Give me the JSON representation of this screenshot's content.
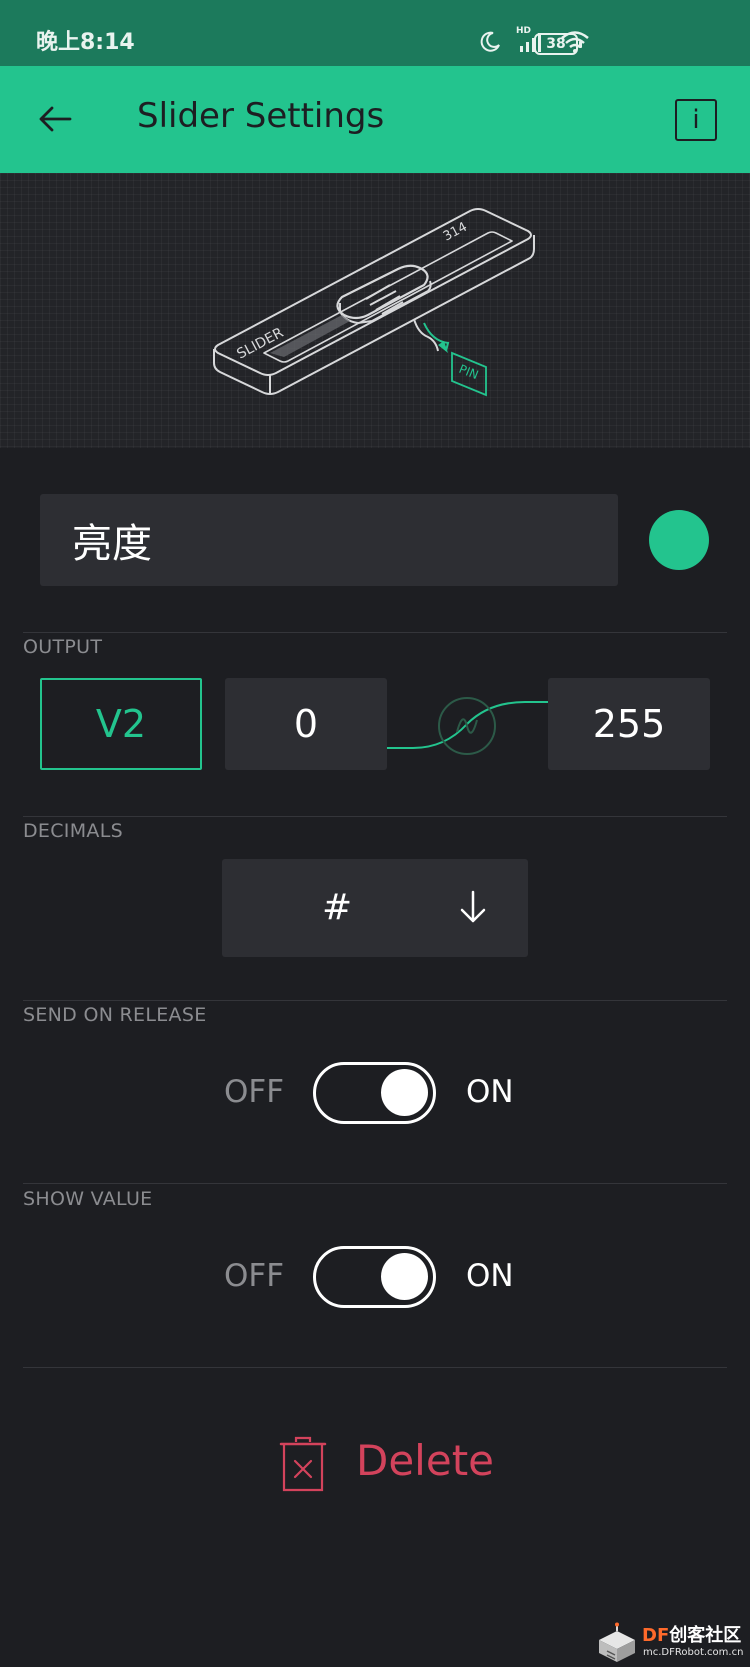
{
  "status_bar": {
    "time": "晚上8:14",
    "network_label": "HD",
    "battery": "38",
    "icons": [
      "moon-icon",
      "signal-icon",
      "wifi-icon",
      "battery-icon"
    ]
  },
  "header": {
    "title": "Slider Settings",
    "back_icon": "arrow-left-icon",
    "info_label": "i"
  },
  "illustration": {
    "slider_label": "SLIDER",
    "value_label": "314",
    "pin_label": "PIN"
  },
  "widget": {
    "name": "亮度",
    "color": "#23c48e"
  },
  "output": {
    "label": "OUTPUT",
    "pin": "V2",
    "min": "0",
    "max": "255"
  },
  "decimals": {
    "label": "DECIMALS",
    "value": "#"
  },
  "send_on_release": {
    "label": "SEND ON RELEASE",
    "off_label": "OFF",
    "on_label": "ON",
    "state": "on"
  },
  "show_value": {
    "label": "SHOW VALUE",
    "off_label": "OFF",
    "on_label": "ON",
    "state": "on"
  },
  "delete": {
    "label": "Delete"
  },
  "watermark": {
    "brand_prefix": "DF",
    "brand_suffix": "创客社区",
    "url": "mc.DFRobot.com.cn"
  },
  "colors": {
    "accent": "#23c48e",
    "background": "#1d1e22",
    "field": "#2d2e33",
    "danger": "#d3435c"
  }
}
